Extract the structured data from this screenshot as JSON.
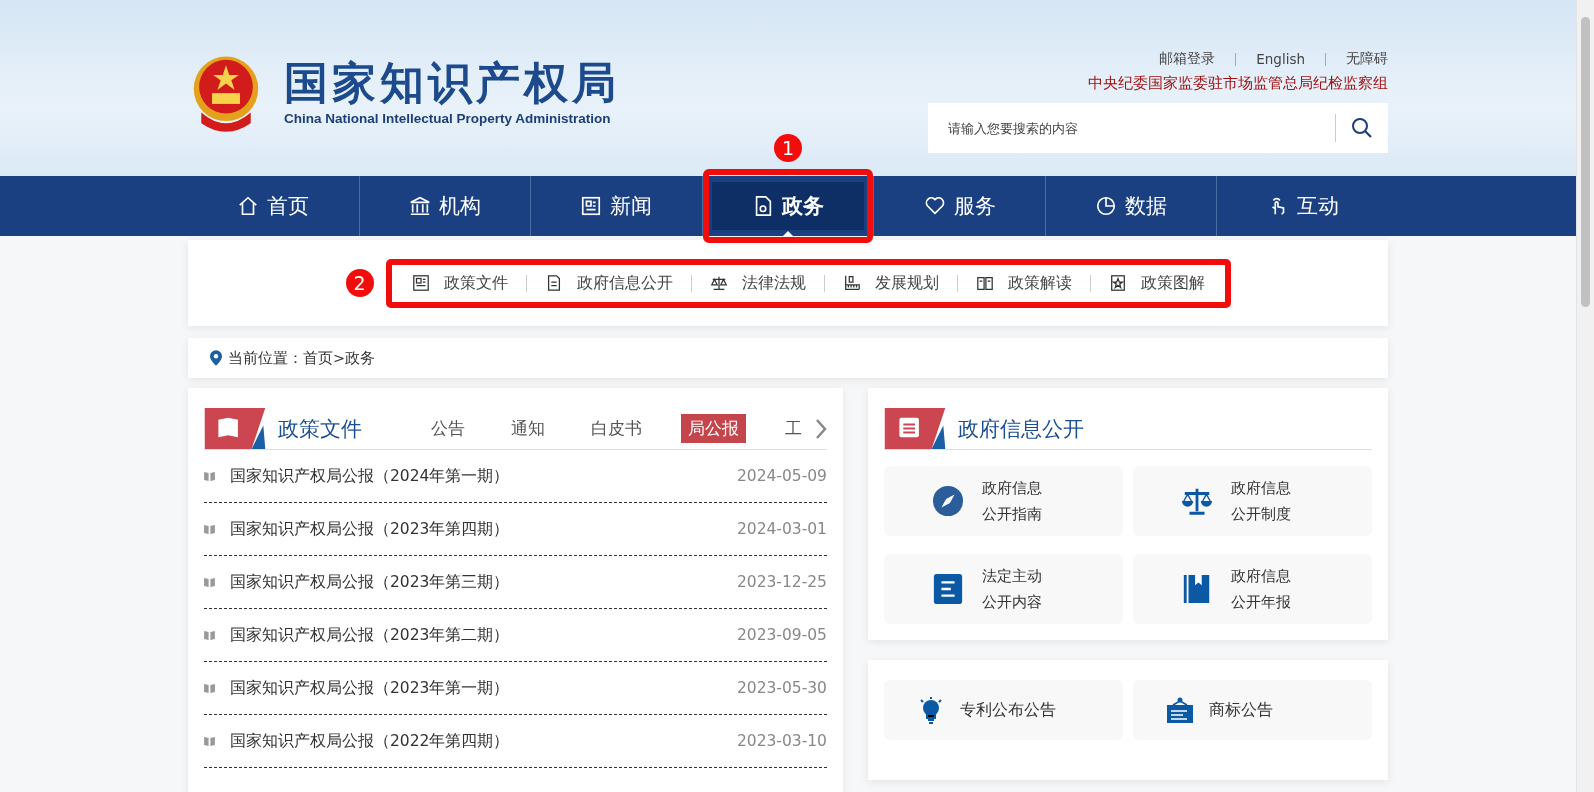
{
  "header": {
    "logo_title": "国家知识产权局",
    "logo_subtitle": "China National Intellectual Property Administration",
    "top_links": [
      "邮箱登录",
      "English",
      "无障碍"
    ],
    "notice": "中央纪委国家监委驻市场监管总局纪检监察组",
    "search": {
      "placeholder": "请输入您要搜索的内容"
    }
  },
  "nav": {
    "annotation": "1",
    "items": [
      {
        "label": "首页",
        "kind": "home",
        "selected": false
      },
      {
        "label": "机构",
        "kind": "building",
        "selected": false
      },
      {
        "label": "新闻",
        "kind": "news",
        "selected": false
      },
      {
        "label": "政务",
        "kind": "file",
        "selected": true
      },
      {
        "label": "服务",
        "kind": "heart",
        "selected": false
      },
      {
        "label": "数据",
        "kind": "pie",
        "selected": false
      },
      {
        "label": "互动",
        "kind": "hand",
        "selected": false
      }
    ]
  },
  "subnav": {
    "annotation": "2",
    "items": [
      {
        "label": "政策文件",
        "kind": "doc"
      },
      {
        "label": "政府信息公开",
        "kind": "page"
      },
      {
        "label": "法律法规",
        "kind": "scale"
      },
      {
        "label": "发展规划",
        "kind": "ruler"
      },
      {
        "label": "政策解读",
        "kind": "book"
      },
      {
        "label": "政策图解",
        "kind": "star"
      }
    ]
  },
  "breadcrumb": "当前位置：首页>政务",
  "policy_panel": {
    "title": "政策文件",
    "tabs": [
      {
        "label": "公告",
        "selected": false
      },
      {
        "label": "通知",
        "selected": false
      },
      {
        "label": "白皮书",
        "selected": false
      },
      {
        "label": "局公报",
        "selected": true
      },
      {
        "label": "工",
        "selected": false
      }
    ],
    "items": [
      {
        "title": "国家知识产权局公报（2024年第一期）",
        "date": "2024-05-09"
      },
      {
        "title": "国家知识产权局公报（2023年第四期）",
        "date": "2024-03-01"
      },
      {
        "title": "国家知识产权局公报（2023年第三期）",
        "date": "2023-12-25"
      },
      {
        "title": "国家知识产权局公报（2023年第二期）",
        "date": "2023-09-05"
      },
      {
        "title": "国家知识产权局公报（2023年第一期）",
        "date": "2023-05-30"
      },
      {
        "title": "国家知识产权局公报（2022年第四期）",
        "date": "2023-03-10"
      }
    ]
  },
  "gov_info_panel": {
    "title": "政府信息公开",
    "tiles": [
      {
        "lines": [
          "政府信息",
          "公开指南"
        ],
        "kind": "compass"
      },
      {
        "lines": [
          "政府信息",
          "公开制度"
        ],
        "kind": "scale"
      },
      {
        "lines": [
          "法定主动",
          "公开内容"
        ],
        "kind": "list"
      },
      {
        "lines": [
          "政府信息",
          "公开年报"
        ],
        "kind": "bookmark"
      }
    ]
  },
  "notice_panel": {
    "tiles": [
      {
        "label": "专利公布公告",
        "kind": "bulb"
      },
      {
        "label": "商标公告",
        "kind": "sign"
      }
    ]
  }
}
